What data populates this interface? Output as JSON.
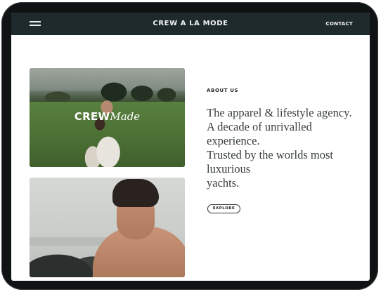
{
  "navbar": {
    "brand": "CREW A LA MODE",
    "contact_label": "CONTACT",
    "background": "#1f2a2d"
  },
  "hero_logo": {
    "bold": "CREW",
    "script": "Made"
  },
  "about": {
    "label": "ABOUT US",
    "tagline_lines": [
      "The apparel & lifestyle agency.",
      "A decade of unrivalled",
      "experience.",
      "Trusted by the worlds most",
      "luxurious",
      "yachts."
    ],
    "button_label": "EXPLORE"
  },
  "icons": {
    "menu": "hamburger-menu-icon"
  }
}
